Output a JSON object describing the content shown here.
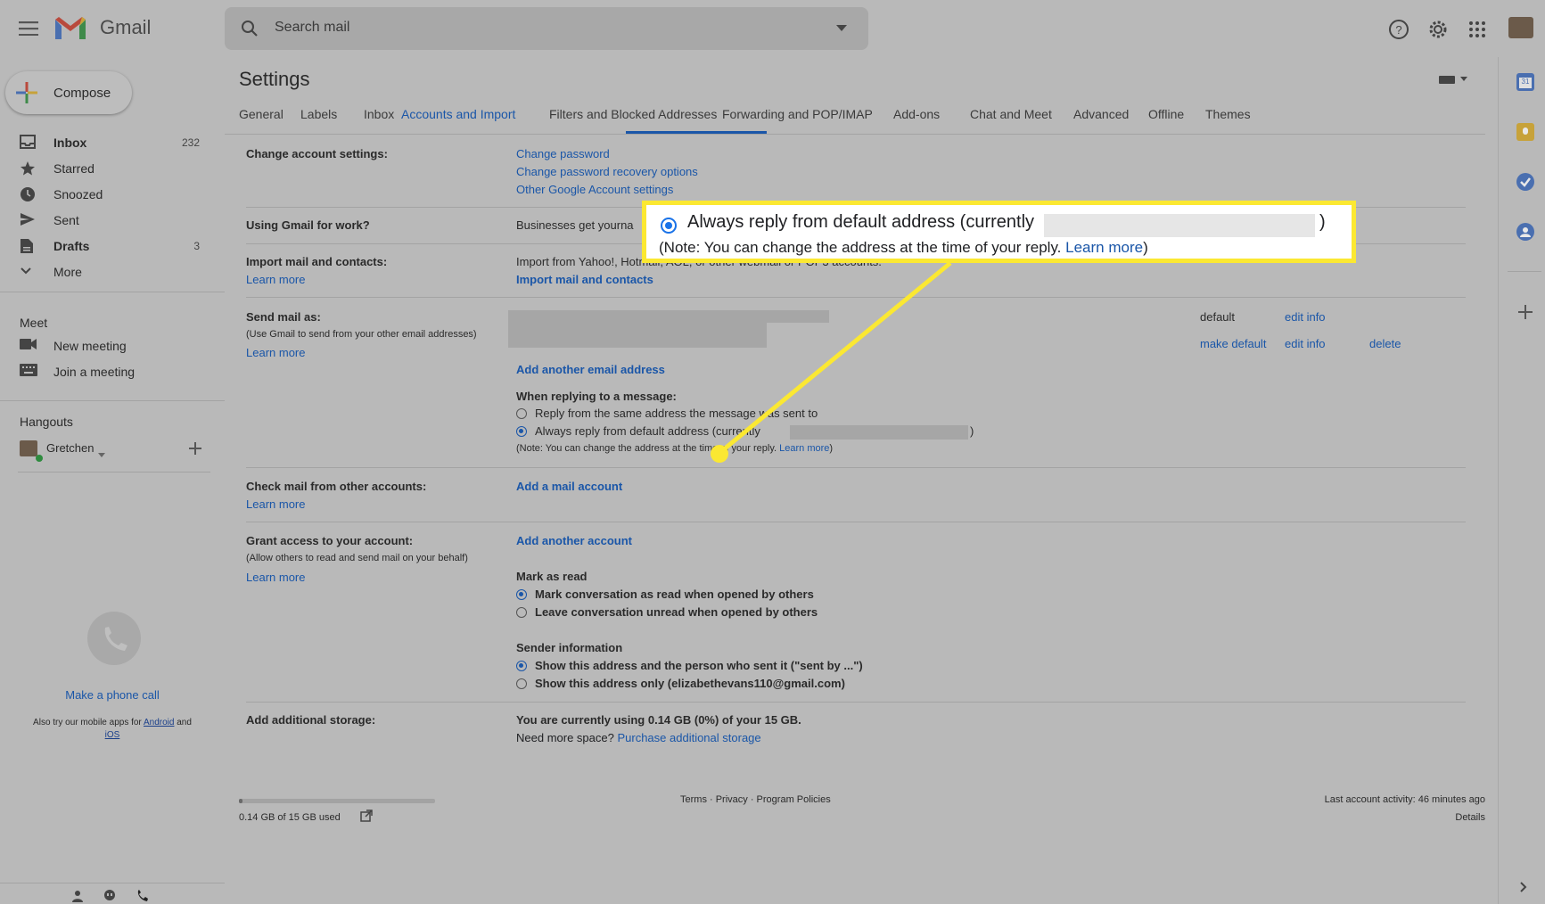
{
  "header": {
    "app_name": "Gmail",
    "search_placeholder": "Search mail"
  },
  "sidebar": {
    "compose_label": "Compose",
    "items": [
      {
        "label": "Inbox",
        "count": "232"
      },
      {
        "label": "Starred",
        "count": ""
      },
      {
        "label": "Snoozed",
        "count": ""
      },
      {
        "label": "Sent",
        "count": ""
      },
      {
        "label": "Drafts",
        "count": "3"
      },
      {
        "label": "More",
        "count": ""
      }
    ],
    "meet_heading": "Meet",
    "meet_items": [
      "New meeting",
      "Join a meeting"
    ],
    "hangouts_heading": "Hangouts",
    "hangouts_user": "Gretchen",
    "phone_call_link": "Make a phone call",
    "mobile_text_1": "Also try our mobile apps for",
    "mobile_android": "Android",
    "mobile_and": "and",
    "mobile_ios": "iOS"
  },
  "settings": {
    "title": "Settings",
    "tabs": [
      "General",
      "Labels",
      "Inbox",
      "Accounts and Import",
      "Filters and Blocked Addresses",
      "Forwarding and POP/IMAP",
      "Add-ons",
      "Chat and Meet",
      "Advanced",
      "Offline",
      "Themes"
    ],
    "change_account": {
      "label": "Change account settings:",
      "links": [
        "Change password",
        "Change password recovery options",
        "Other Google Account settings"
      ]
    },
    "gmail_work": {
      "label": "Using Gmail for work?",
      "text": "Businesses get yourna"
    },
    "import": {
      "label": "Import mail and contacts:",
      "learn_more": "Learn more",
      "text": "Import from Yahoo!, Hotmail, AOL, or other webmail or POP3 accounts.",
      "action": "Import mail and contacts"
    },
    "send_mail_as": {
      "label": "Send mail as:",
      "sub": "(Use Gmail to send from your other email addresses)",
      "learn_more": "Learn more",
      "default_label": "default",
      "edit_info": "edit info",
      "make_default": "make default",
      "delete": "delete",
      "add_another": "Add another email address",
      "reply_heading": "When replying to a message:",
      "reply_opt1": "Reply from the same address the message was sent to",
      "reply_opt2": "Always reply from default address (currently",
      "reply_opt2_end": ")",
      "note": "(Note: You can change the address at the time of your reply.",
      "note_link": "Learn more",
      "note_end": ")"
    },
    "check_mail": {
      "label": "Check mail from other accounts:",
      "learn_more": "Learn more",
      "action": "Add a mail account"
    },
    "grant_access": {
      "label": "Grant access to your account:",
      "sub": "(Allow others to read and send mail on your behalf)",
      "learn_more": "Learn more",
      "action": "Add another account",
      "mark_heading": "Mark as read",
      "mark_opt1": "Mark conversation as read when opened by others",
      "mark_opt2": "Leave conversation unread when opened by others",
      "sender_heading": "Sender information",
      "sender_opt1": "Show this address and the person who sent it (\"sent by ...\")",
      "sender_opt2": "Show this address only (elizabethevans110@gmail.com)"
    },
    "storage": {
      "label": "Add additional storage:",
      "usage": "You are currently using 0.14 GB (0%) of your 15 GB.",
      "need_more": "Need more space?",
      "purchase": "Purchase additional storage"
    }
  },
  "footer": {
    "used": "0.14 GB of 15 GB used",
    "storage_fraction": 0.01,
    "links": "Terms · Privacy · Program Policies",
    "activity": "Last account activity: 46 minutes ago",
    "details": "Details"
  },
  "callout": {
    "line1": "Always reply from default address (currently",
    "line1_end": ")",
    "line2": "(Note: You can change the address at the time of your reply.",
    "line2_link": "Learn more",
    "line2_end": ")",
    "highlight_color": "#fbe832"
  },
  "colors": {
    "link": "#1a56a8",
    "accent_blue": "#1a73e8"
  }
}
